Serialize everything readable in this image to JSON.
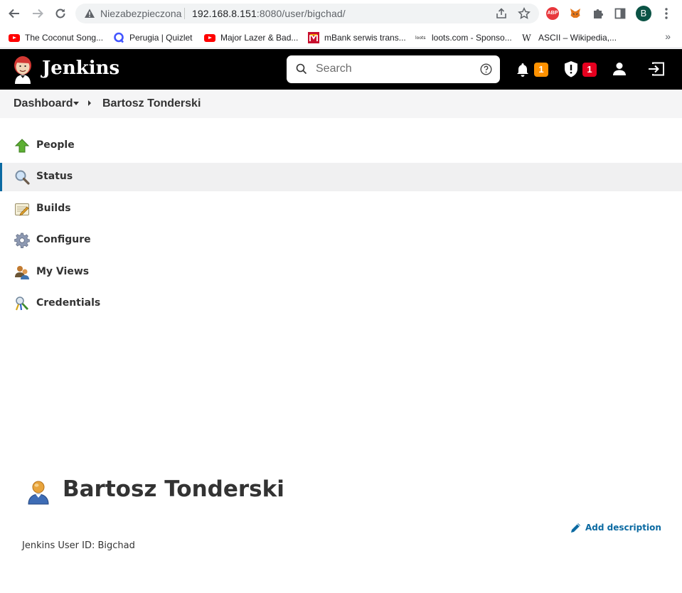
{
  "browser": {
    "insecure_label": "Niezabezpieczona",
    "url_host": "192.168.8.151",
    "url_path": ":8080/user/bigchad/",
    "profile_initial": "B",
    "extensions": [
      "abp-icon",
      "metamask-fox-icon",
      "puzzle-icon",
      "sidepanel-icon"
    ],
    "abp_label": "ABP"
  },
  "bookmarks": [
    {
      "label": "The Coconut Song...",
      "icon": "youtube-icon"
    },
    {
      "label": "Perugia | Quizlet",
      "icon": "quizlet-icon"
    },
    {
      "label": "Major Lazer & Bad...",
      "icon": "youtube-icon"
    },
    {
      "label": "mBank serwis trans...",
      "icon": "mbank-icon"
    },
    {
      "label": "loots.com - Sponso...",
      "icon": "loots-icon"
    },
    {
      "label": "ASCII – Wikipedia,...",
      "icon": "wikipedia-icon"
    }
  ],
  "bookmarks_more": "»",
  "header": {
    "title": "Jenkins",
    "search_placeholder": "Search",
    "notifications_count": "1",
    "security_count": "1"
  },
  "breadcrumb": {
    "dashboard": "Dashboard",
    "current": "Bartosz Tonderski"
  },
  "tasks": [
    {
      "label": "People",
      "icon": "green-arrow-up-icon"
    },
    {
      "label": "Status",
      "icon": "magnifier-icon",
      "active": true
    },
    {
      "label": "Builds",
      "icon": "notepad-icon"
    },
    {
      "label": "Configure",
      "icon": "gear-icon"
    },
    {
      "label": "My Views",
      "icon": "users-icon"
    },
    {
      "label": "Credentials",
      "icon": "credentials-icon"
    }
  ],
  "main": {
    "user_name": "Bartosz Tonderski",
    "add_description": "Add description",
    "user_id_line": "Jenkins User ID: Bigchad"
  },
  "colors": {
    "header_bg": "#000000",
    "breadcrumb_bg": "#f5f5f6",
    "active_task_bg": "#f0f0f1",
    "link": "#0b6aa2",
    "badge_orange": "#fe9100",
    "badge_red": "#e6001f"
  }
}
